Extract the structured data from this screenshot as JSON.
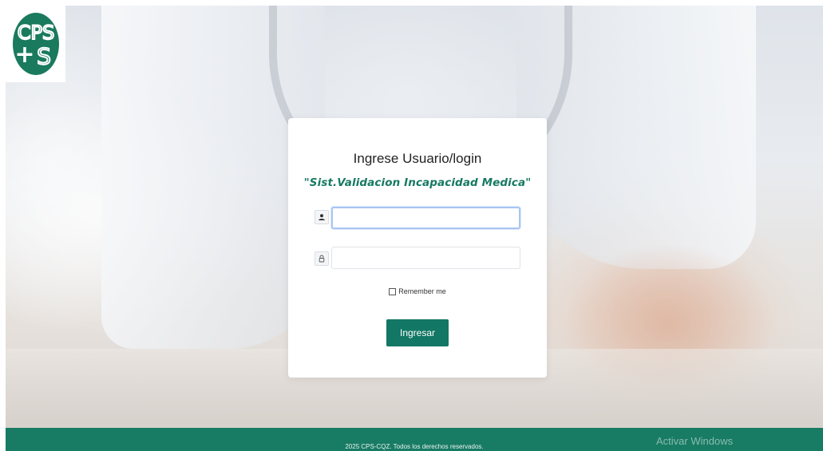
{
  "logo": {
    "alt_text": "CPS"
  },
  "login": {
    "title": "Ingrese Usuario/login",
    "subtitle": "\"Sist.Validacion Incapacidad Medica\"",
    "username": {
      "value": "",
      "placeholder": "",
      "icon": "user-icon"
    },
    "password": {
      "value": "",
      "placeholder": "",
      "icon": "lock-icon"
    },
    "remember_label": "Remember me",
    "remember_checked": false,
    "submit_label": "Ingresar"
  },
  "footer": {
    "copyright": "2025 CPS-CQZ. Todos los derechos reservados.",
    "watermark": "Activar Windows"
  },
  "colors": {
    "brand_green": "#127764",
    "subtitle_green": "#177a63",
    "footer_green": "#187b64"
  }
}
